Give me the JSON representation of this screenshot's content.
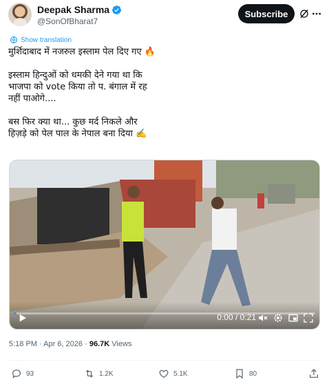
{
  "author": {
    "name": "Deepak Sharma",
    "handle": "@SonOfBharat7",
    "verified": true
  },
  "header": {
    "subscribe_label": "Subscribe"
  },
  "translate_label": "Show translation",
  "tweet": {
    "line1": "मुर्शिदाबाद में नजरुल इस्लाम पेल दिए गए 🔥",
    "line2": "इस्लाम हिन्दुओं को धमकी देने गया था कि",
    "line3": "भाजपा को vote किया तो प. बंगाल में रह",
    "line4": "नहीं पाओगे....",
    "line5": "बस फिर क्या था... कुछ मर्द निकले और",
    "line6": "हिज़ड़े को पेल पाल के नेपाल बना दिया ✍️"
  },
  "video": {
    "time": "0:00 / 0:21",
    "progress": 0.0
  },
  "meta": {
    "time": "5:18 PM",
    "separator": "·",
    "date": "Apr 6, 2026",
    "views_count": "96.7K",
    "views_label": "Views"
  },
  "actions": {
    "replies": "93",
    "reposts": "1.2K",
    "likes": "5.1K",
    "bookmarks": "80"
  },
  "colors": {
    "accent": "#1d9bf0",
    "text": "#0f1419",
    "secondary": "#536471"
  }
}
